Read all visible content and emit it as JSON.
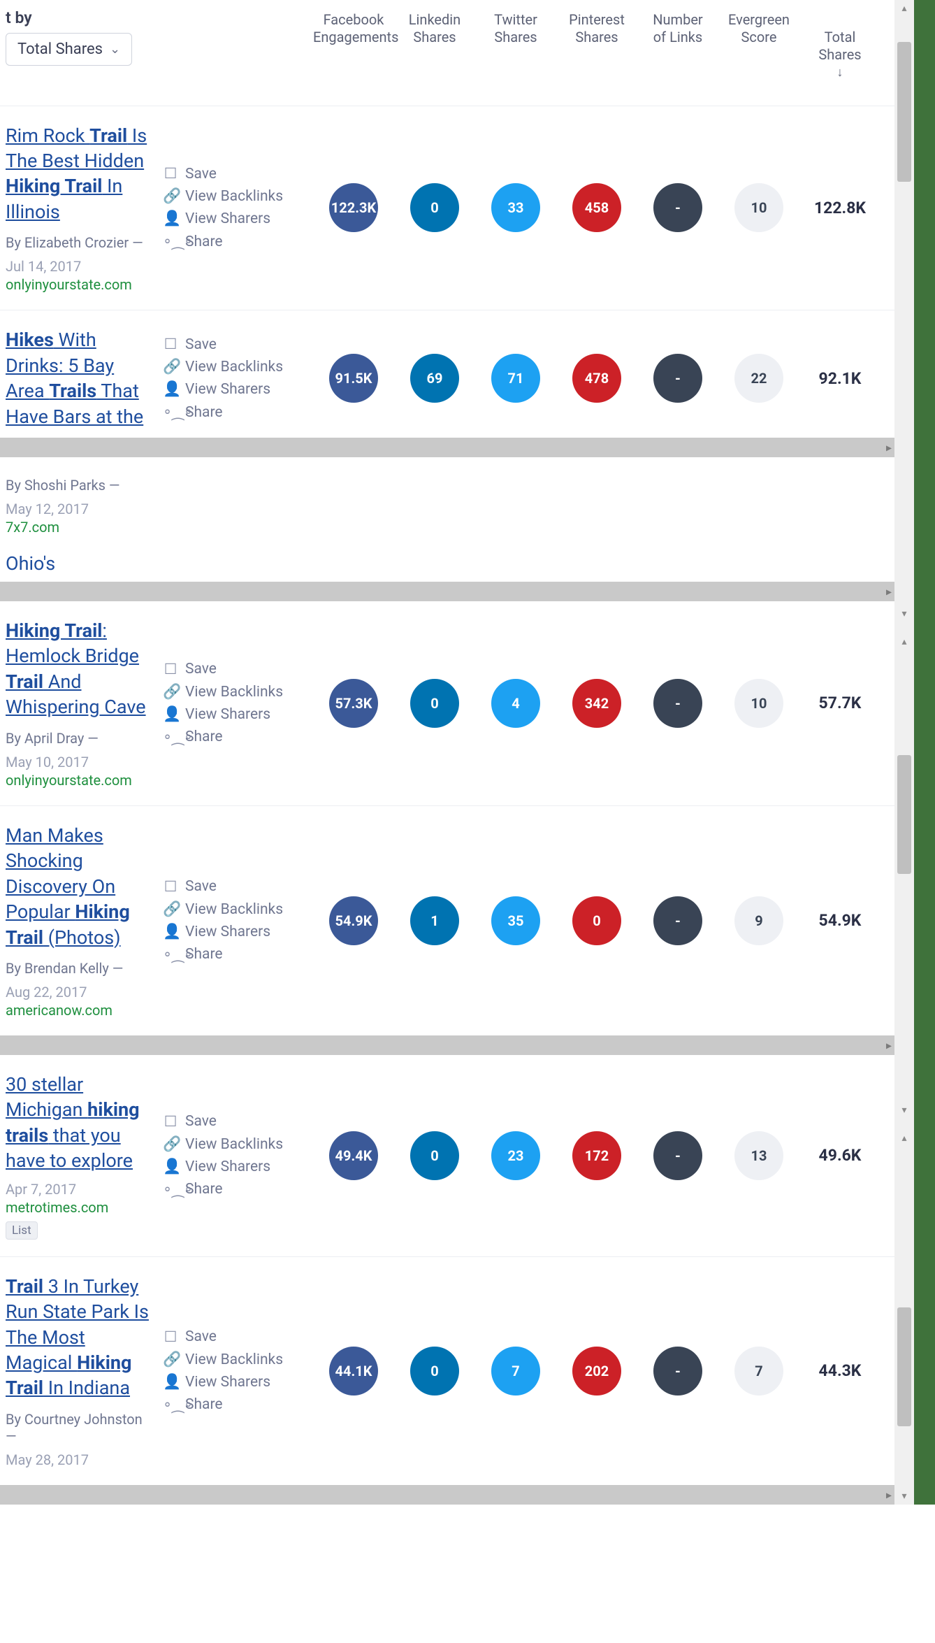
{
  "sort": {
    "label": "t by",
    "selected": "Total Shares"
  },
  "columns": {
    "facebook": "Facebook\nEngagements",
    "linkedin": "Linkedin\nShares",
    "twitter": "Twitter\nShares",
    "pinterest": "Pinterest\nShares",
    "links": "Number\nof Links",
    "evergreen": "Evergreen\nScore",
    "total": "Total\nShares"
  },
  "actions": {
    "save": "Save",
    "backlinks": "View Backlinks",
    "sharers": "View Sharers",
    "share": "Share"
  },
  "ohio_stub": "Ohio's",
  "rows": [
    {
      "title_html": "Rim Rock <b>Trail</b> Is The Best Hidden <b>Hiking Trail</b> In Illinois",
      "author": "By Elizabeth Crozier —",
      "date": "Jul 14, 2017",
      "domain": "onlyinyourstate.com",
      "tag": "",
      "fb": "122.3K",
      "li": "0",
      "tw": "33",
      "pi": "458",
      "nl": "-",
      "eg": "10",
      "total": "122.8K"
    },
    {
      "title_html": "<b>Hikes</b> With Drinks: 5 Bay Area <b>Trails</b> That Have Bars at the",
      "author": "By Shoshi Parks —",
      "date": "May 12, 2017",
      "domain": "7x7.com",
      "tag": "",
      "fb": "91.5K",
      "li": "69",
      "tw": "71",
      "pi": "478",
      "nl": "-",
      "eg": "22",
      "total": "92.1K"
    },
    {
      "title_html": "<b>Hiking Trail</b>: Hemlock Bridge <b>Trail</b> And Whispering Cave",
      "author": "By April Dray —",
      "date": "May 10, 2017",
      "domain": "onlyinyourstate.com",
      "tag": "",
      "fb": "57.3K",
      "li": "0",
      "tw": "4",
      "pi": "342",
      "nl": "-",
      "eg": "10",
      "total": "57.7K"
    },
    {
      "title_html": "Man Makes Shocking Discovery On Popular <b>Hiking Trail</b> (Photos)",
      "author": "By Brendan Kelly —",
      "date": "Aug 22, 2017",
      "domain": "americanow.com",
      "tag": "",
      "fb": "54.9K",
      "li": "1",
      "tw": "35",
      "pi": "0",
      "nl": "-",
      "eg": "9",
      "total": "54.9K"
    },
    {
      "title_html": "30 stellar Michigan <b>hiking trails</b> that you have to explore",
      "author": "",
      "date": "Apr 7, 2017",
      "domain": "metrotimes.com",
      "tag": "List",
      "fb": "49.4K",
      "li": "0",
      "tw": "23",
      "pi": "172",
      "nl": "-",
      "eg": "13",
      "total": "49.6K"
    },
    {
      "title_html": "<b>Trail</b> 3 In Turkey Run State Park Is The Most Magical <b>Hiking Trail</b> In Indiana",
      "author": "By Courtney Johnston —",
      "date": "May 28, 2017",
      "domain": "",
      "tag": "",
      "fb": "44.1K",
      "li": "0",
      "tw": "7",
      "pi": "202",
      "nl": "-",
      "eg": "7",
      "total": "44.3K"
    }
  ]
}
